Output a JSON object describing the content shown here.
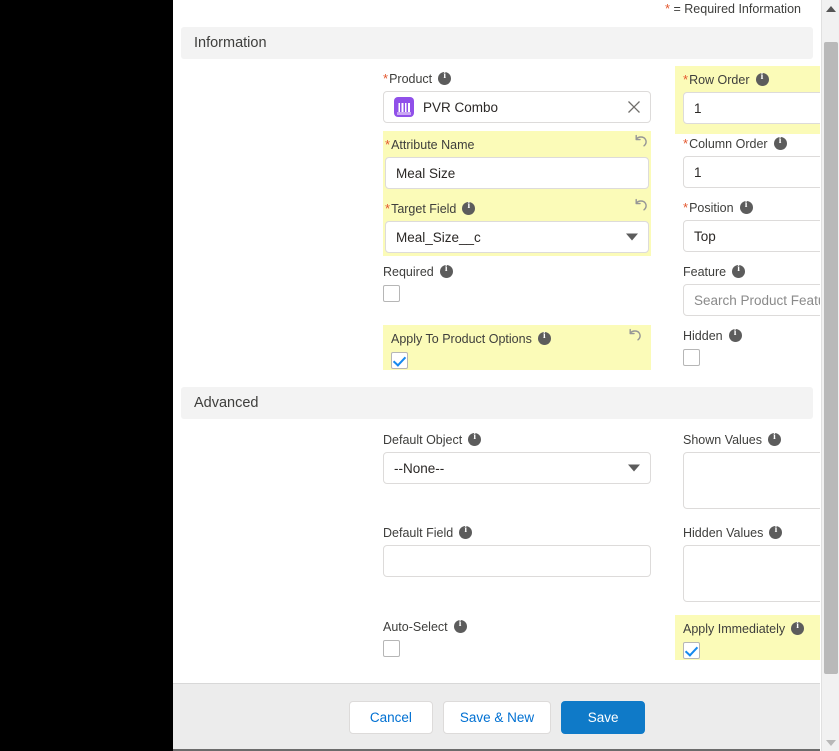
{
  "required_note": {
    "star": "*",
    "text": "= Required Information"
  },
  "sections": {
    "information": {
      "title": "Information"
    },
    "advanced": {
      "title": "Advanced"
    }
  },
  "fields": {
    "product": {
      "label": "Product",
      "required_star": "*",
      "value": "PVR Combo",
      "icon": "product-pill-icon",
      "clear_icon": "close-icon"
    },
    "row_order": {
      "label": "Row Order",
      "required_star": "*",
      "value": "1",
      "undo_icon": "undo-icon"
    },
    "attribute_name": {
      "label": "Attribute Name",
      "required_star": "*",
      "value": "Meal Size",
      "undo_icon": "undo-icon"
    },
    "column_order": {
      "label": "Column Order",
      "required_star": "*",
      "value": "1",
      "dropdown_icon": "chevron-down-icon"
    },
    "target_field": {
      "label": "Target Field",
      "required_star": "*",
      "value": "Meal_Size__c",
      "undo_icon": "undo-icon",
      "dropdown_icon": "chevron-down-icon"
    },
    "position": {
      "label": "Position",
      "required_star": "*",
      "value": "Top",
      "dropdown_icon": "chevron-down-icon"
    },
    "required": {
      "label": "Required",
      "checked": false
    },
    "feature": {
      "label": "Feature",
      "placeholder": "Search Product Features...",
      "value": "",
      "search_icon": "search-icon"
    },
    "apply_to_product_options": {
      "label": "Apply To Product Options",
      "checked": true,
      "undo_icon": "undo-icon"
    },
    "hidden": {
      "label": "Hidden",
      "checked": false
    },
    "default_object": {
      "label": "Default Object",
      "value": "--None--",
      "dropdown_icon": "chevron-down-icon"
    },
    "shown_values": {
      "label": "Shown Values",
      "value": "",
      "resize_icon": "resize-handle-icon"
    },
    "default_field": {
      "label": "Default Field",
      "value": ""
    },
    "hidden_values": {
      "label": "Hidden Values",
      "value": "",
      "resize_icon": "resize-handle-icon"
    },
    "auto_select": {
      "label": "Auto-Select",
      "checked": false
    },
    "apply_immediately": {
      "label": "Apply Immediately",
      "checked": true,
      "undo_icon": "undo-icon"
    }
  },
  "footer": {
    "cancel_label": "Cancel",
    "save_new_label": "Save & New",
    "save_label": "Save"
  },
  "colors": {
    "highlight": "#fbfbb8",
    "required_star": "#e4572e",
    "brand_button": "#0f7ac8",
    "link_text": "#0070d2",
    "product_icon": "#9050e9",
    "checkbox_check": "#1589ee"
  }
}
